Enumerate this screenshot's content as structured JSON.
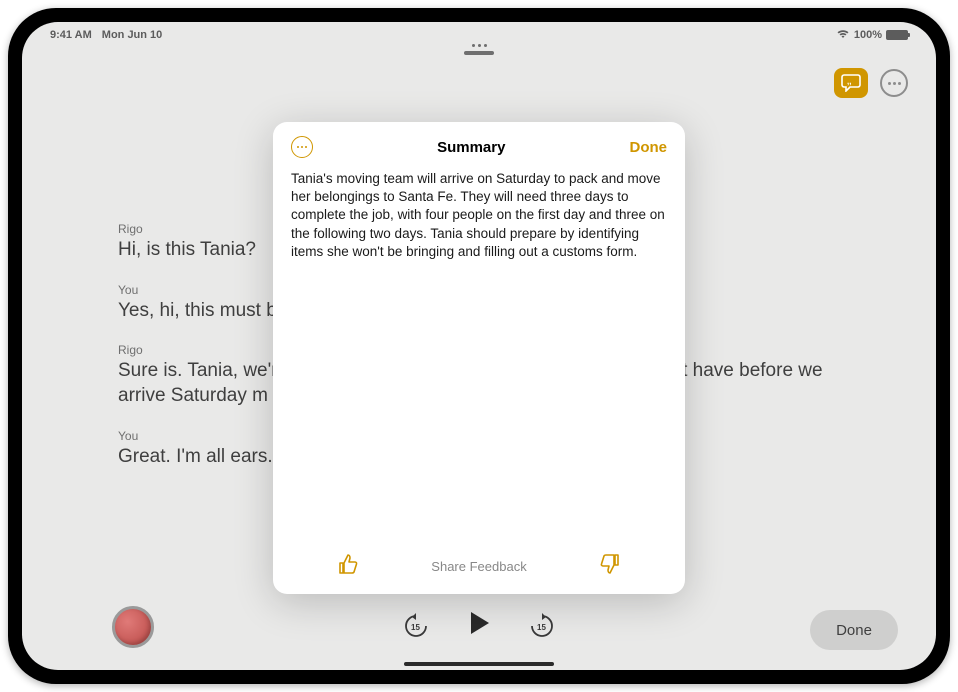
{
  "statusbar": {
    "time": "9:41 AM",
    "date": "Mon Jun 10",
    "battery_pct": "100%"
  },
  "top_actions": {
    "speech_icon": "speech-bubble-quote-icon",
    "more_icon": "ellipsis-circle-icon"
  },
  "transcript": [
    {
      "speaker": "Rigo",
      "text": "Hi, is this Tania?"
    },
    {
      "speaker": "You",
      "text": "Yes, hi, this must be l"
    },
    {
      "speaker": "Rigo",
      "text": "Sure is. Tania, we're c                                                                             o chat with you beforehand to go ove                                                                         u might have before we arrive Saturday m"
    },
    {
      "speaker": "You",
      "text": "Great. I'm all ears."
    }
  ],
  "playback": {
    "rewind_label": "15",
    "forward_label": "15",
    "done_label": "Done"
  },
  "modal": {
    "title": "Summary",
    "done_label": "Done",
    "body": "Tania's moving team will arrive on Saturday to pack and move her belongings to Santa Fe. They will need three days to complete the job, with four people on the first day and three on the following two days. Tania should prepare by identifying items she won't be bringing and filling out a customs form.",
    "share_feedback": "Share Feedback"
  },
  "colors": {
    "accent": "#d09600"
  }
}
